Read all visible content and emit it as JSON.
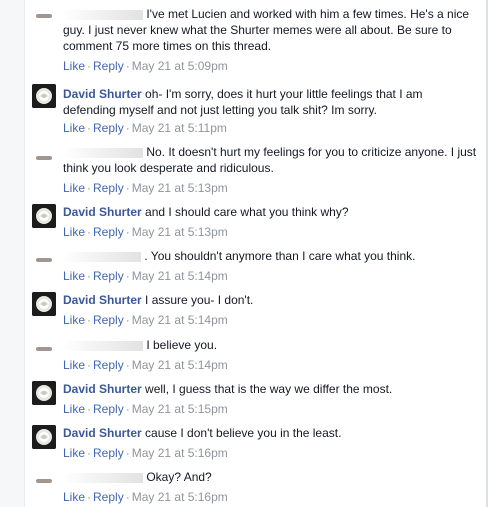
{
  "actions": {
    "like": "Like",
    "reply": "Reply",
    "separator": "·"
  },
  "comments": [
    {
      "author": "",
      "avatar": "redacted-avatar",
      "text": "I've met Lucien and worked with him a few times. He's a nice guy. I just never knew what the Shurter memes were all about. Be sure to comment 75 more times on this thread.",
      "time": "May 21 at 5:09pm"
    },
    {
      "author": "David Shurter",
      "avatar": "white-rose-avatar",
      "text": "oh- I'm sorry, does it hurt your little feelings that I am defending myself and not just letting you talk shit? Im sorry.",
      "time": "May 21 at 5:11pm"
    },
    {
      "author": "",
      "avatar": "redacted-avatar",
      "text": "No. It doesn't hurt my feelings for you to criticize anyone. I just think you look desperate and ridiculous.",
      "time": "May 21 at 5:13pm"
    },
    {
      "author": "David Shurter",
      "avatar": "white-rose-avatar",
      "text": "and I should care what you think why?",
      "time": "May 21 at 5:13pm"
    },
    {
      "author": "",
      "avatar": "redacted-avatar",
      "text": ". You shouldn't anymore than I care what you think.",
      "time": "May 21 at 5:14pm"
    },
    {
      "author": "David Shurter",
      "avatar": "white-rose-avatar",
      "text": "I assure you- I don't.",
      "time": "May 21 at 5:14pm"
    },
    {
      "author": "",
      "avatar": "redacted-avatar",
      "text": "I believe you.",
      "time": "May 21 at 5:14pm"
    },
    {
      "author": "David Shurter",
      "avatar": "white-rose-avatar",
      "text": "well, I guess that is the way we differ the most.",
      "time": "May 21 at 5:15pm"
    },
    {
      "author": "David Shurter",
      "avatar": "white-rose-avatar",
      "text": "cause I don't believe you in the least.",
      "time": "May 21 at 5:16pm"
    },
    {
      "author": "",
      "avatar": "redacted-avatar",
      "text": "Okay? And?",
      "time": "May 21 at 5:16pm"
    }
  ]
}
